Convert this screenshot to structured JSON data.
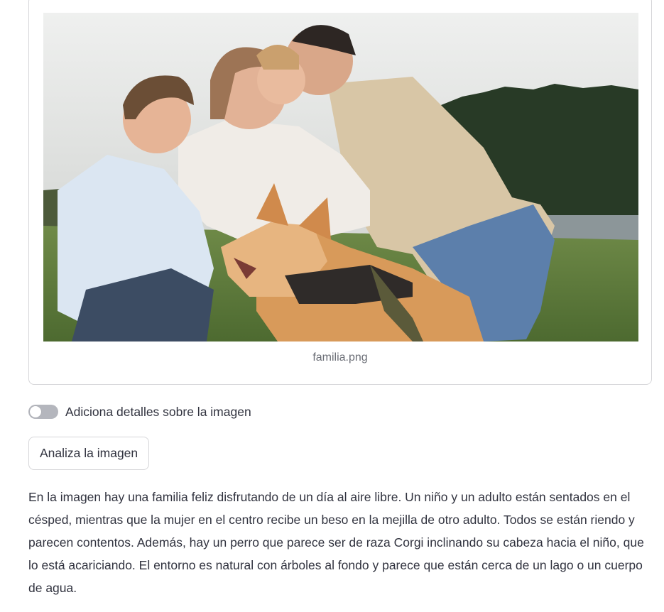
{
  "image_card": {
    "image_alt": "Familia feliz al aire libre con un perro corgi",
    "caption": "familia.png"
  },
  "details_toggle": {
    "label": "Adiciona detalles sobre la imagen",
    "checked": false
  },
  "analyze_button": {
    "label": "Analiza la imagen"
  },
  "result": {
    "text": "En la imagen hay una familia feliz disfrutando de un día al aire libre. Un niño y un adulto están sentados en el césped, mientras que la mujer en el centro recibe un beso en la mejilla de otro adulto. Todos se están riendo y parecen contentos. Además, hay un perro que parece ser de raza Corgi inclinando su cabeza hacia el niño, que lo está acariciando. El entorno es natural con árboles al fondo y parece que están cerca de un lago o un cuerpo de agua."
  },
  "colors": {
    "text": "#31333f",
    "caption": "#6b6e76",
    "border": "#d6d6d9",
    "toggle_off": "#b4b6bd"
  }
}
